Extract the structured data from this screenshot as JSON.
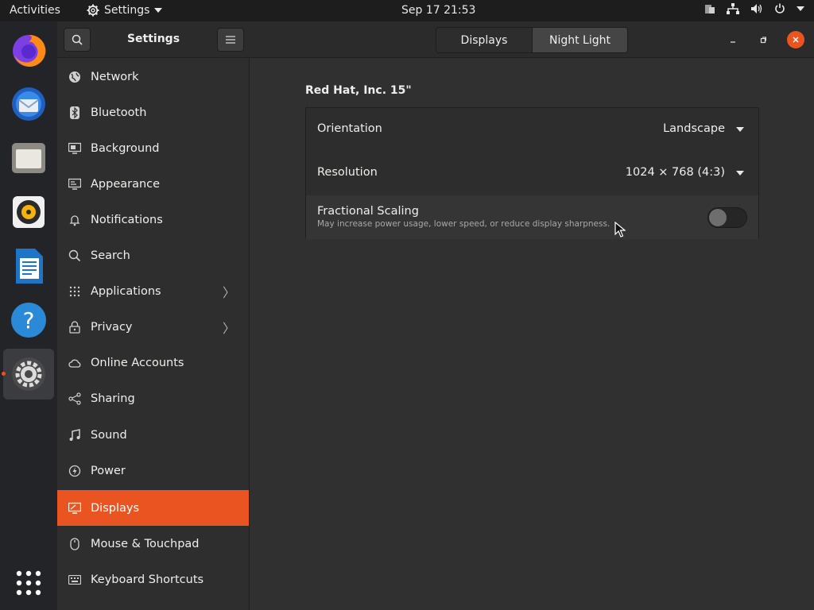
{
  "topbar": {
    "activities": "Activities",
    "app_menu": "Settings",
    "clock": "Sep 17  21:53"
  },
  "dock": {
    "items": [
      "firefox-icon",
      "thunderbird-icon",
      "files-icon",
      "rhythmbox-icon",
      "libreoffice-writer-icon",
      "help-icon",
      "settings-icon",
      "show-apps-icon"
    ]
  },
  "sidebar": {
    "title": "Settings",
    "items": [
      {
        "label": "Network",
        "icon": "globe-icon"
      },
      {
        "label": "Bluetooth",
        "icon": "bluetooth-icon"
      },
      {
        "label": "Background",
        "icon": "background-icon"
      },
      {
        "label": "Appearance",
        "icon": "appearance-icon"
      },
      {
        "label": "Notifications",
        "icon": "bell-icon"
      },
      {
        "label": "Search",
        "icon": "search-icon"
      },
      {
        "label": "Applications",
        "icon": "grid-icon"
      },
      {
        "label": "Privacy",
        "icon": "lock-icon"
      },
      {
        "label": "Online Accounts",
        "icon": "cloud-icon"
      },
      {
        "label": "Sharing",
        "icon": "share-icon"
      },
      {
        "label": "Sound",
        "icon": "music-icon"
      },
      {
        "label": "Power",
        "icon": "power-icon"
      },
      {
        "label": "Displays",
        "icon": "display-icon"
      },
      {
        "label": "Mouse & Touchpad",
        "icon": "mouse-icon"
      },
      {
        "label": "Keyboard Shortcuts",
        "icon": "keyboard-icon"
      }
    ],
    "selected": "Displays"
  },
  "header": {
    "tabs": [
      {
        "label": "Displays"
      },
      {
        "label": "Night Light"
      }
    ],
    "selected_tab": "Night Light"
  },
  "display": {
    "monitor_name": "Red Hat, Inc. 15\"",
    "orientation_label": "Orientation",
    "orientation_value": "Landscape",
    "resolution_label": "Resolution",
    "resolution_value": "1024 × 768 (4:3)",
    "fractional_label": "Fractional Scaling",
    "fractional_sub": "May increase power usage, lower speed, or reduce display sharpness.",
    "fractional_enabled": false
  },
  "colors": {
    "accent": "#e95420",
    "background": "#303030",
    "topbar": "#1d1d1d",
    "dock": "#222428"
  }
}
